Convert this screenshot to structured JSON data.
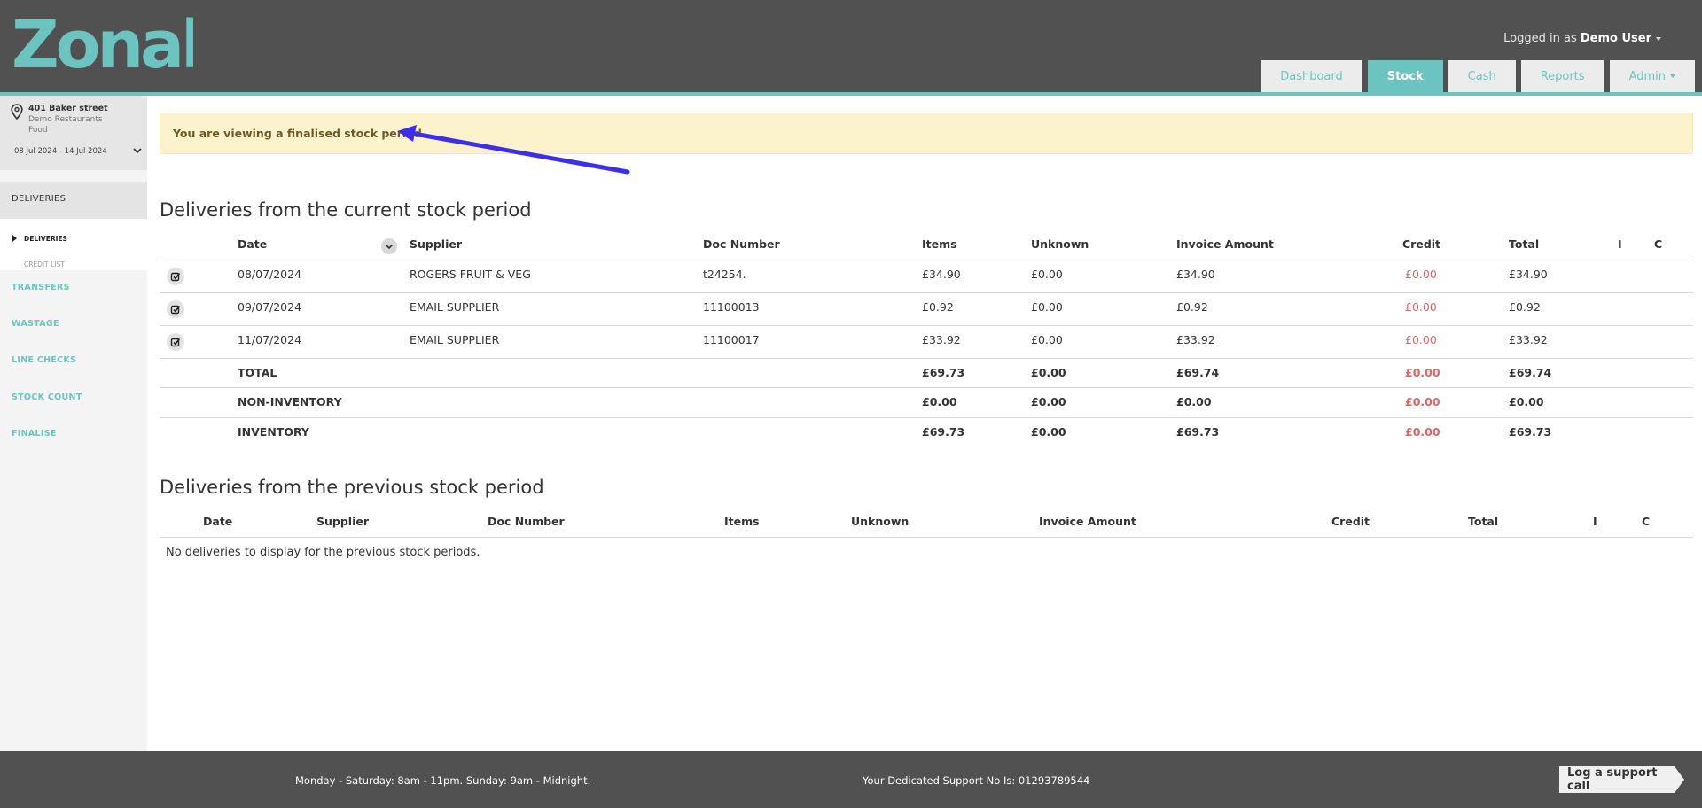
{
  "header": {
    "logo_text": "Zonal",
    "logged_in_prefix": "Logged in as",
    "user_name": "Demo User",
    "tabs": [
      {
        "label": "Dashboard",
        "active": false
      },
      {
        "label": "Stock",
        "active": true
      },
      {
        "label": "Cash",
        "active": false
      },
      {
        "label": "Reports",
        "active": false
      },
      {
        "label": "Admin",
        "active": false
      }
    ],
    "accent_color": "#6cc4c1",
    "bar_color": "#515151"
  },
  "sidebar": {
    "location_name": "401 Baker street",
    "organisation": "Demo Restaurants",
    "category": "Food",
    "period": "08 Jul 2024 - 14 Jul 2024",
    "section_heading": "DELIVERIES",
    "sub_items": [
      "DELIVERIES",
      "CREDIT LIST"
    ],
    "links": [
      "TRANSFERS",
      "WASTAGE",
      "LINE CHECKS",
      "STOCK COUNT",
      "FINALISE"
    ]
  },
  "alert": {
    "text": "You are viewing a finalised stock period",
    "arrow_color": "#3d2ee8"
  },
  "current": {
    "title": "Deliveries from the current stock period",
    "columns": [
      "Date",
      "Supplier",
      "Doc Number",
      "Items",
      "Unknown",
      "Invoice Amount",
      "Credit",
      "Total",
      "I",
      "C"
    ],
    "rows": [
      {
        "date": "08/07/2024",
        "supplier": "ROGERS FRUIT & VEG",
        "doc": "t24254.",
        "items": "£34.90",
        "unknown": "£0.00",
        "invoice": "£34.90",
        "credit": "£0.00",
        "total": "£34.90"
      },
      {
        "date": "09/07/2024",
        "supplier": "EMAIL SUPPLIER",
        "doc": "11100013",
        "items": "£0.92",
        "unknown": "£0.00",
        "invoice": "£0.92",
        "credit": "£0.00",
        "total": "£0.92"
      },
      {
        "date": "11/07/2024",
        "supplier": "EMAIL SUPPLIER",
        "doc": "11100017",
        "items": "£33.92",
        "unknown": "£0.00",
        "invoice": "£33.92",
        "credit": "£0.00",
        "total": "£33.92"
      }
    ],
    "summary": [
      {
        "label": "TOTAL",
        "items": "£69.73",
        "unknown": "£0.00",
        "invoice": "£69.74",
        "credit": "£0.00",
        "total": "£69.74"
      },
      {
        "label": "NON-INVENTORY",
        "items": "£0.00",
        "unknown": "£0.00",
        "invoice": "£0.00",
        "credit": "£0.00",
        "total": "£0.00"
      },
      {
        "label": "INVENTORY",
        "items": "£69.73",
        "unknown": "£0.00",
        "invoice": "£69.73",
        "credit": "£0.00",
        "total": "£69.73"
      }
    ]
  },
  "previous": {
    "title": "Deliveries from the previous stock period",
    "columns": [
      "Date",
      "Supplier",
      "Doc Number",
      "Items",
      "Unknown",
      "Invoice Amount",
      "Credit",
      "Total",
      "I",
      "C"
    ],
    "empty_message": "No deliveries to display for the previous stock periods."
  },
  "footer": {
    "hours": "Monday - Saturday: 8am - 11pm. Sunday: 9am - Midnight.",
    "support": "Your Dedicated Support No Is: 01293789544",
    "support_button": "Log a support call"
  }
}
